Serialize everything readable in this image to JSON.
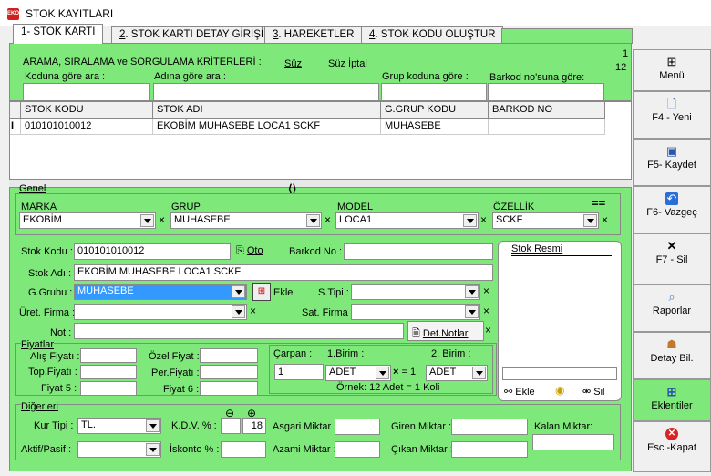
{
  "window": {
    "title": "STOK KAYITLARI",
    "icon": "app-logo-icon",
    "app_logo_text": "EKO"
  },
  "tabs": [
    {
      "key": "1",
      "label": "- STOK KARTI"
    },
    {
      "key": "2",
      "label": ". STOK KARTI DETAY GİRİŞİ"
    },
    {
      "key": "3",
      "label": ". HAREKETLER"
    },
    {
      "key": "4",
      "label": ". STOK KODU OLUŞTUR"
    }
  ],
  "filter": {
    "heading": "ARAMA, SIRALAMA ve SORGULAMA KRİTERLERİ :",
    "filter_label": "Süz",
    "cancel_label": "Süz İptal",
    "page_num": "1",
    "page_count": "12",
    "code_label": "Koduna göre ara :",
    "name_label": "Adına göre ara :",
    "group_label": "Grup koduna göre :",
    "barcode_label": "Barkod no'suna göre:"
  },
  "grid": {
    "columns": [
      "STOK KODU",
      "STOK ADI",
      "G.GRUP KODU",
      "BARKOD NO"
    ],
    "row_marker": "I",
    "rows": [
      [
        "010101010012",
        "EKOBİM MUHASEBE LOCA1 SCKF",
        "MUHASEBE",
        ""
      ]
    ]
  },
  "genel": {
    "title": "Genel",
    "marka_label": "MARKA",
    "marka": "EKOBİM",
    "grup_label": "GRUP",
    "grup": "MUHASEBE",
    "model_label": "MODEL",
    "model": "LOCA1",
    "ozellik_label": "ÖZELLİK",
    "ozellik": "SCKF",
    "stok_kodu_label": "Stok Kodu :",
    "stok_kodu": "010101010012",
    "oto_label": "Oto",
    "barkod_label": "Barkod No :",
    "barkod": "",
    "stok_adi_label": "Stok Adı :",
    "stok_adi": "EKOBİM MUHASEBE LOCA1 SCKF",
    "ggrubu_label": "G.Grubu :",
    "ggrubu": "MUHASEBE",
    "ekle_label": "Ekle",
    "stipi_label": "S.Tipi :",
    "stipi": "",
    "uret_label": "Üret. Firma :",
    "uret": "",
    "sat_label": "Sat. Firma :",
    "sat": "",
    "not_label": "Not :",
    "not": "",
    "det_notlar_label": "Det.Notlar"
  },
  "fiyatlar": {
    "title": "Fiyatlar",
    "alis_label": "Alış Fiyatı :",
    "top_label": "Top.Fiyatı :",
    "f5_label": "Fiyat 5 :",
    "ozel_label": "Özel Fiyat :",
    "per_label": "Per.Fiyatı :",
    "f6_label": "Fiyat 6 :",
    "carpan_label": "Çarpan :",
    "carpan": "1",
    "birim1_label": "1.Birim :",
    "birim1": "ADET",
    "eq": "= 1",
    "birim2_label": "2. Birim :",
    "birim2": "ADET",
    "ornek": "Örnek: 12 Adet = 1  Koli"
  },
  "resim": {
    "title": "Stok Resmi",
    "ekle_label": "Ekle",
    "sil_label": "Sil"
  },
  "diger": {
    "title": "Diğerleri",
    "kur_label": "Kur Tipi :",
    "kur": "TL.",
    "aktif_label": "Aktif/Pasif :",
    "aktif": "",
    "kdv_label": "K.D.V. % :",
    "kdv1": "",
    "kdv2": "18",
    "iskonto_label": "İskonto % :",
    "iskonto": "",
    "asgari_label": "Asgari Miktar :",
    "azami_label": "Azami Miktar :",
    "giren_label": "Giren Miktar :",
    "cikan_label": "Çıkan Miktar :",
    "kalan_label": "Kalan Miktar:"
  },
  "side": [
    {
      "label": "Menü",
      "icon": "menu-icon"
    },
    {
      "label": "F4 - Yeni",
      "icon": "new-document-icon"
    },
    {
      "label": "F5- Kaydet",
      "icon": "save-disk-icon"
    },
    {
      "label": "F6- Vazgeç",
      "icon": "undo-icon"
    },
    {
      "label": "F7 - Sil",
      "icon": "delete-x-icon"
    },
    {
      "label": "Raporlar",
      "icon": "report-magnifier-icon"
    },
    {
      "label": "Detay Bil.",
      "icon": "detail-info-icon"
    },
    {
      "label": "Eklentiler",
      "icon": "addons-grid-icon"
    },
    {
      "label": "Esc -Kapat",
      "icon": "close-circle-icon"
    }
  ]
}
